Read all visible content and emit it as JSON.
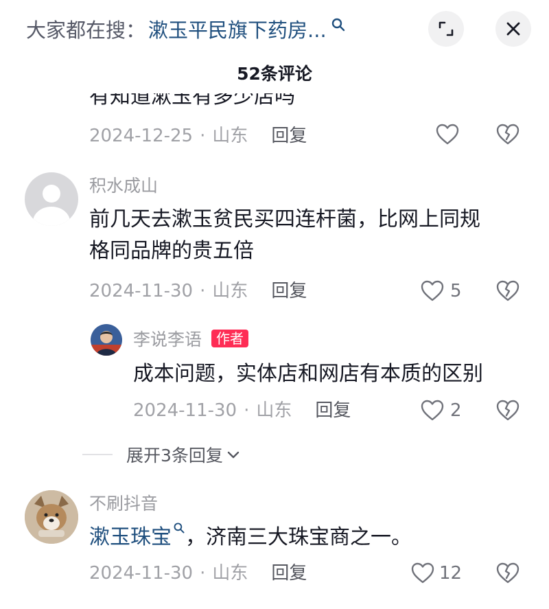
{
  "header": {
    "search_prefix": "大家都在搜：",
    "search_query": "漱玉平民旗下药房...",
    "comment_count": "52条评论"
  },
  "clipped_comment": {
    "partial_text": "有知道漱玉有多少店吗",
    "date": "2024-12-25",
    "location": "山东",
    "reply_label": "回复"
  },
  "comments": [
    {
      "username": "积水成山",
      "text_line1": "前几天去漱玉贫民买四连杆菌，比网上同规",
      "text_line2": "格同品牌的贵五倍",
      "date": "2024-11-30",
      "location": "山东",
      "reply_label": "回复",
      "likes": "5"
    },
    {
      "username": "不刷抖音",
      "link_text": "漱玉珠宝",
      "text_rest": "，济南三大珠宝商之一。",
      "date": "2024-11-30",
      "location": "山东",
      "reply_label": "回复",
      "likes": "12"
    }
  ],
  "reply": {
    "username": "李说李语",
    "badge": "作者",
    "text": "成本问题，实体店和网店有本质的区别",
    "date": "2024-11-30",
    "location": "山东",
    "reply_label": "回复",
    "likes": "2"
  },
  "expand_replies": "展开3条回复",
  "separator": "·",
  "colors": {
    "link": "#1f4f7e",
    "author_badge": "#fe2c55",
    "muted_text": "#a0a1a6"
  }
}
